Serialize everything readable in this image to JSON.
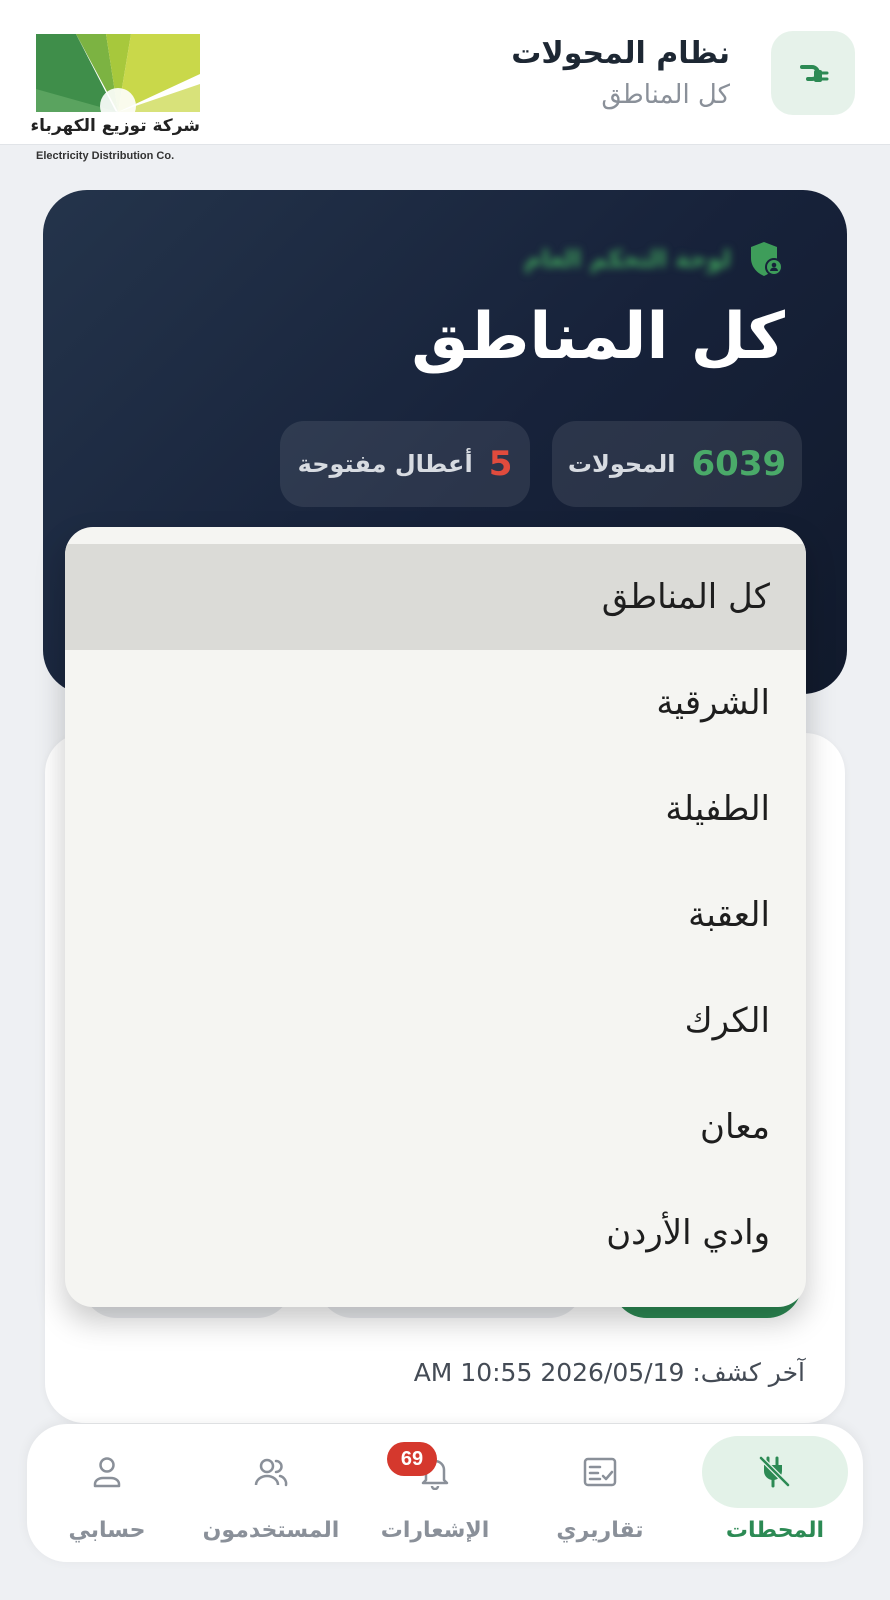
{
  "header": {
    "title": "نظام المحولات",
    "subtitle": "كل المناطق",
    "app_icon": "plug-icon",
    "logo": {
      "arabic": "شركة توزيع الكهرباء",
      "english": "Electricity Distribution Co."
    }
  },
  "hero": {
    "role_label": "لوحة التحكم العام",
    "role_icon": "shield-user-icon",
    "title": "كل المناطق",
    "stats": {
      "transformers": {
        "value": "6039",
        "label": "المحولات"
      },
      "faults": {
        "value": "5",
        "label": "أعطال مفتوحة"
      }
    }
  },
  "dropdown": {
    "selected": "كل المناطق",
    "options": [
      "كل المناطق",
      "الشرقية",
      "الطفيلة",
      "العقبة",
      "الكرك",
      "معان",
      "وادي الأردن"
    ]
  },
  "content": {
    "last_scan": "آخر كشف: 2026/05/19 10:55 AM"
  },
  "nav": {
    "items": [
      {
        "label": "المحطات",
        "icon": "plug-off-icon",
        "active": true
      },
      {
        "label": "تقاريري",
        "icon": "report-checklist-icon",
        "active": false
      },
      {
        "label": "الإشعارات",
        "icon": "bell-icon",
        "active": false
      },
      {
        "label": "المستخدمون",
        "icon": "users-icon",
        "active": false
      },
      {
        "label": "حسابي",
        "icon": "user-icon",
        "active": false
      }
    ],
    "notifications_badge": "69"
  },
  "colors": {
    "accent_green": "#2c8a54",
    "stat_green": "#4aaa69",
    "alert_red": "#e04b3d",
    "hero_dark": "#17223a"
  }
}
